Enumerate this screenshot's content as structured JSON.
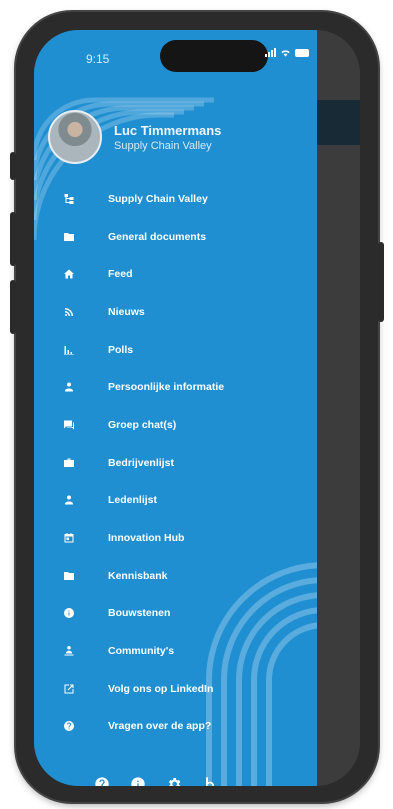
{
  "status_bar": {
    "time": "9:15"
  },
  "profile": {
    "name": "Luc Timmermans",
    "organization": "Supply Chain Valley"
  },
  "menu": {
    "items": [
      {
        "label": "Supply Chain Valley",
        "icon": "org-tree-icon"
      },
      {
        "label": "General documents",
        "icon": "folder-icon"
      },
      {
        "label": "Feed",
        "icon": "home-icon"
      },
      {
        "label": "Nieuws",
        "icon": "rss-icon"
      },
      {
        "label": "Polls",
        "icon": "bar-chart-icon"
      },
      {
        "label": "Persoonlijke informatie",
        "icon": "person-icon"
      },
      {
        "label": "Groep chat(s)",
        "icon": "chat-icon"
      },
      {
        "label": "Bedrijvenlijst",
        "icon": "briefcase-icon"
      },
      {
        "label": "Ledenlijst",
        "icon": "person-icon"
      },
      {
        "label": "Innovation Hub",
        "icon": "calendar-icon"
      },
      {
        "label": "Kennisbank",
        "icon": "folder-icon"
      },
      {
        "label": "Bouwstenen",
        "icon": "info-icon"
      },
      {
        "label": "Community's",
        "icon": "people-icon"
      },
      {
        "label": "Volg ons op LinkedIn",
        "icon": "external-link-icon"
      },
      {
        "label": "Vragen over de app?",
        "icon": "help-icon"
      }
    ]
  },
  "bottom_bar": {
    "icons": [
      "help-icon",
      "info-icon",
      "settings-icon",
      "brand-b-icon"
    ]
  },
  "colors": {
    "drawer": "#1f8fd1",
    "backdrop": "#3c3c3c",
    "backdrop_bar": "#172a36"
  }
}
